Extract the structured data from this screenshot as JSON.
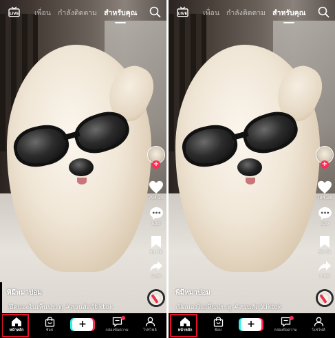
{
  "screens": [
    {
      "nav": {
        "tabs": [
          "เพื่อน",
          "กำลังติดตาม",
          "สำหรับคุณ"
        ],
        "active_tab": "สำหรับคุณ"
      },
      "actions": {
        "likes": "794.2K",
        "comments": "529",
        "saves": "53.7K",
        "shares": "9.8K"
      },
      "caption": {
        "author": "พิมีหมาปอม",
        "description": "เปิดมองไม่เห็นประตู #สวนสัตว์tiktok"
      },
      "bottom_nav": {
        "home": "หน้าหลัก",
        "shop": "ช้อป",
        "inbox": "กล่องข้อความ",
        "profile": "โปรไฟล์",
        "create": "+"
      }
    },
    {
      "nav": {
        "tabs": [
          "เพื่อน",
          "กำลังติดตาม",
          "สำหรับคุณ"
        ],
        "active_tab": "สำหรับคุณ"
      },
      "actions": {
        "likes": "794.2K",
        "comments": "529",
        "saves": "53.7K",
        "shares": "9.8K"
      },
      "caption": {
        "author": "พิมีหมาปอม",
        "description": "เปิดมองไม่เห็นประตู #สวนสัตว์tiktok"
      },
      "bottom_nav": {
        "home": "หน้าหลัก",
        "shop": "ช้อป",
        "inbox": "กล่องข้อความ",
        "profile": "โปรไฟล์",
        "create": "+"
      }
    }
  ],
  "colors": {
    "accent_red": "#fe2c55",
    "accent_cyan": "#25f4ee",
    "highlight_box": "#e8132a"
  },
  "icons": [
    "live-icon",
    "search-icon",
    "heart-icon",
    "comment-icon",
    "bookmark-icon",
    "share-icon",
    "music-disc-icon",
    "home-icon",
    "shop-bag-icon",
    "create-plus-icon",
    "inbox-icon",
    "profile-icon"
  ],
  "highlight": "home-tab"
}
